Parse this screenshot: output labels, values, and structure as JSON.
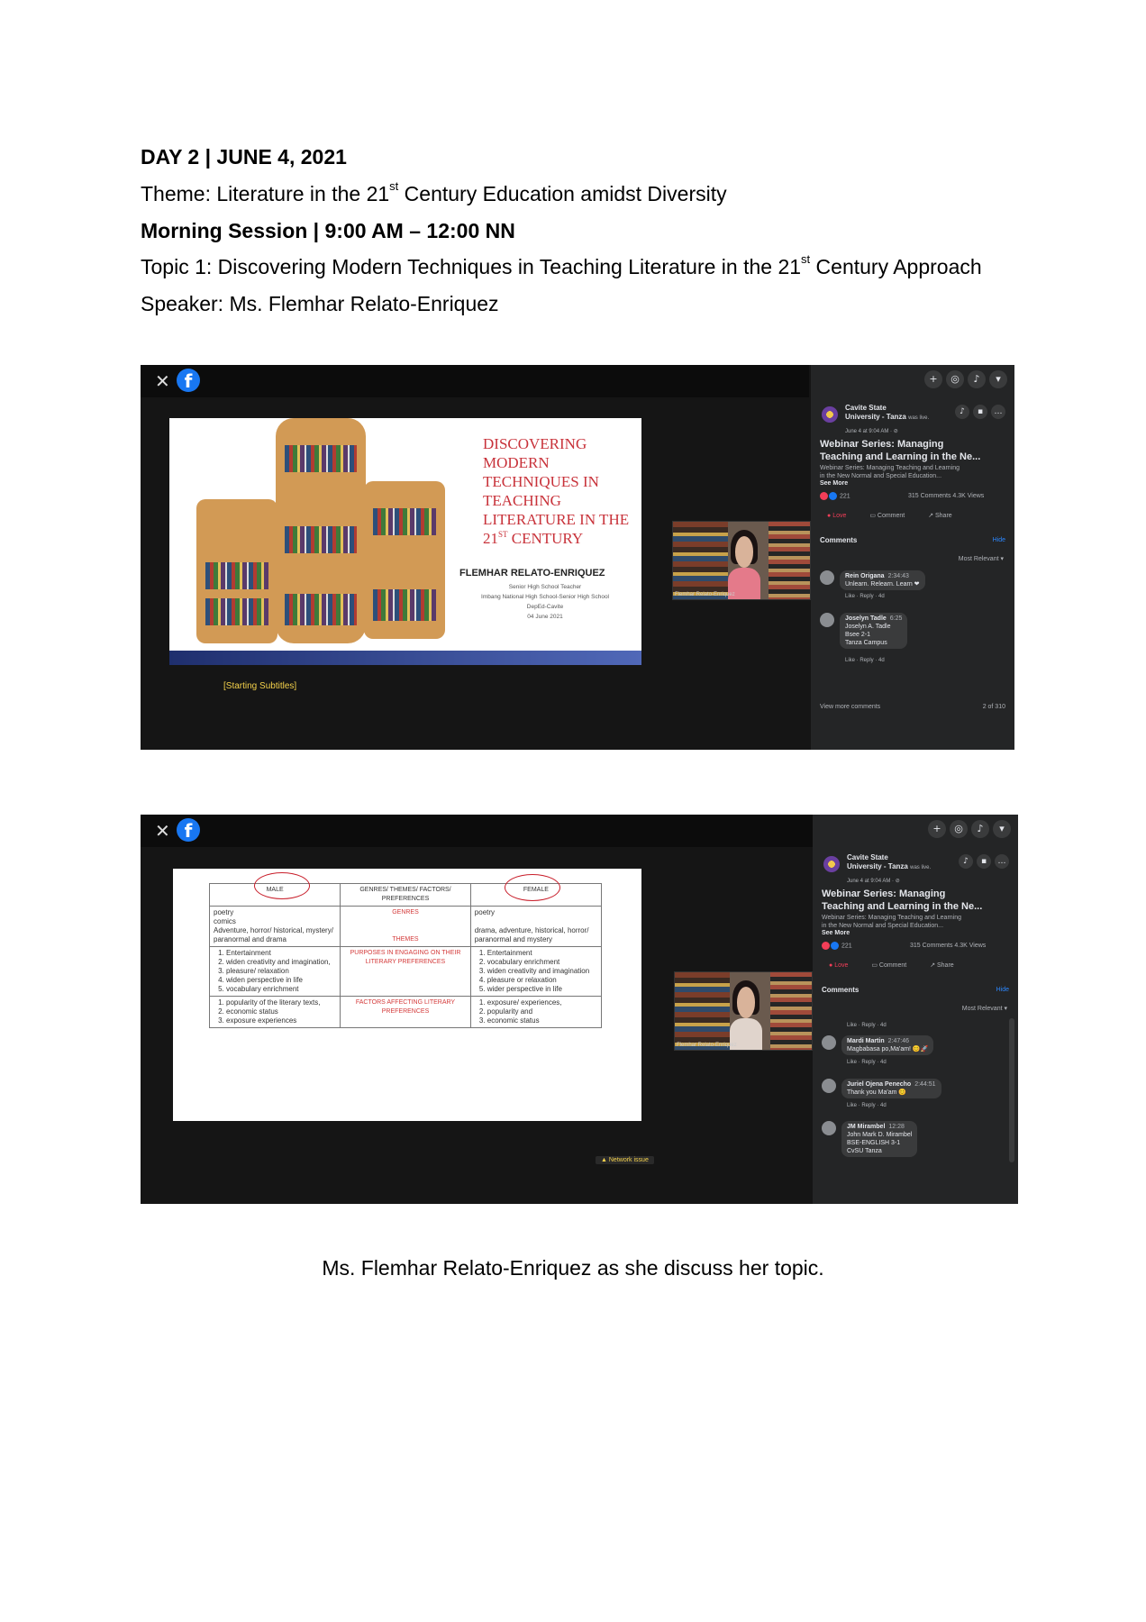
{
  "header": {
    "day": "DAY 2 | JUNE 4, 2021",
    "theme_prefix": "Theme: Literature in the 21",
    "theme_sup": "st",
    "theme_suffix": " Century Education amidst Diversity",
    "session": "Morning Session | 9:00 AM – 12:00 NN",
    "topic_prefix": "Topic 1: Discovering Modern Techniques in Teaching Literature in the 21",
    "topic_sup": "st",
    "topic_suffix": " Century Approach",
    "speaker": "Speaker: Ms. Flemhar Relato-Enriquez"
  },
  "shot1": {
    "slide_title_lines": [
      "DISCOVERING",
      "MODERN",
      "TECHNIQUES IN",
      "TEACHING",
      "LITERATURE IN THE",
      "21"
    ],
    "slide_title_sup": "ST",
    "slide_title_tail": " CENTURY",
    "speaker_name": "FLEMHAR RELATO-ENRIQUEZ",
    "speaker_lines": [
      "Senior High School Teacher",
      "Imbang National High School-Senior High School",
      "DepEd-Cavite",
      "04 June 2021"
    ],
    "subtitles": "[Starting Subtitles]",
    "cam_name": "Flemhar Relato-Enriquez"
  },
  "sidebar": {
    "page_name_1": "Cavite State",
    "page_name_2": "University - Tanza",
    "page_name_suffix": "was live.",
    "post_time": "June 4 at 9:04 AM · ⊘",
    "title_line1": "Webinar Series: Managing",
    "title_line2": "Teaching and Learning in the Ne...",
    "desc_line1": "Webinar Series: Managing Teaching and Learning",
    "desc_line2": "in the New Normal and Special Education...",
    "see_more": "See More",
    "reactions": "221",
    "stats": "315 Comments  4.3K Views",
    "love_label": "Love",
    "comment_label": "Comment",
    "share_label": "Share",
    "comments_heading": "Comments",
    "hide_label": "Hide",
    "most_relevant": "Most Relevant ▾",
    "like_reply": "Like · Reply · 4d",
    "view_more": "View more comments",
    "count": "2 of 310"
  },
  "comments1": [
    {
      "name": "Rein Origana",
      "time": "2:34:43",
      "text": "Unlearn. Relearn. Learn ❤"
    },
    {
      "name": "Joselyn Tadle",
      "time": "6:25",
      "text": "Joselyn A. Tadle",
      "extra": [
        "Bsee 2-1",
        "Tanza Campus"
      ]
    }
  ],
  "shot2": {
    "table_headers": [
      "MALE",
      "GENRES/ THEMES/ FACTORS/ PREFERENCES",
      "FEMALE"
    ],
    "rows": [
      {
        "left": [
          "poetry",
          "comics",
          "Adventure, horror/ historical, mystery/ paranormal and drama"
        ],
        "mid": [
          "GENRES",
          "THEMES"
        ],
        "right": [
          "poetry",
          "drama, adventure, historical, horror/ paranormal and mystery"
        ]
      },
      {
        "left_list": [
          "Entertainment",
          "widen creativity and imagination,",
          "pleasure/ relaxation",
          "widen perspective in life",
          "vocabulary enrichment"
        ],
        "mid": [
          "PURPOSES IN ENGAGING ON THEIR LITERARY PREFERENCES"
        ],
        "right_list": [
          "Entertainment",
          "vocabulary enrichment",
          "widen creativity and imagination",
          "pleasure or relaxation",
          "wider perspective in life"
        ]
      },
      {
        "left_list": [
          "popularity of the literary texts,",
          "economic status",
          "exposure experiences"
        ],
        "mid": [
          "FACTORS AFFECTING LITERARY PREFERENCES"
        ],
        "right_list": [
          "exposure/ experiences,",
          "popularity and",
          "economic status"
        ]
      }
    ],
    "network": "▲ Network issue",
    "cam_name": "Flemhar Relato-Enriquez"
  },
  "comments2": [
    {
      "name": "Mardi Martin",
      "time": "2:47:46",
      "text": "Magbabasa po,Ma'am! 😊🚀"
    },
    {
      "name": "Juriel Ojena Penecho",
      "time": "2:44:51",
      "text": "Thank you Ma'am 😊"
    },
    {
      "name": "JM Mirambel",
      "time": "12:28",
      "text": "John Mark D. Mirambel",
      "extra": [
        "BSE-ENGLISH 3-1",
        "CvSU Tanza"
      ]
    }
  ],
  "footer": {
    "caption": "Ms. Flemhar Relato-Enriquez as she discuss her topic."
  }
}
